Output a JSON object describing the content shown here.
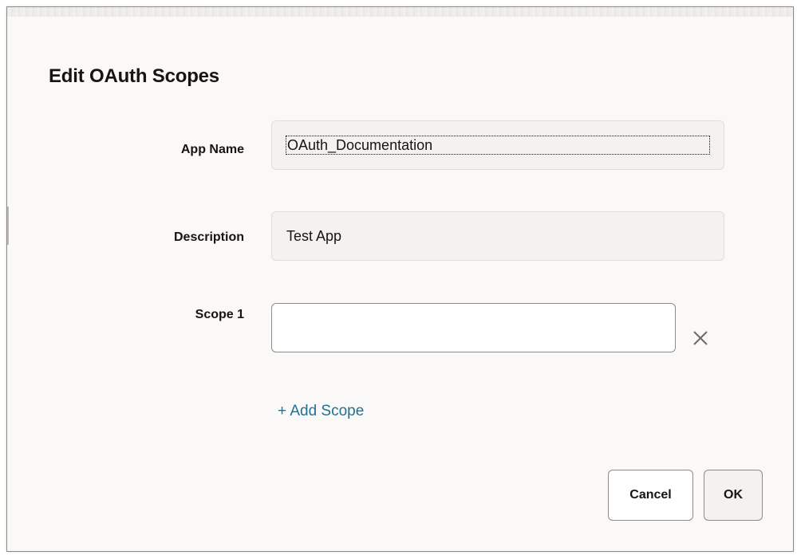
{
  "dialog": {
    "title": "Edit OAuth Scopes",
    "fields": {
      "app_name": {
        "label": "App Name",
        "value": "OAuth_Documentation"
      },
      "description": {
        "label": "Description",
        "value": "Test App"
      },
      "scope_1": {
        "label": "Scope 1",
        "value": ""
      }
    },
    "remove_icon": "close-icon",
    "add_scope_label": "+ Add Scope",
    "buttons": {
      "cancel": "Cancel",
      "ok": "OK"
    }
  },
  "colors": {
    "link": "#227191",
    "dialog_background": "#fbf9f8",
    "readonly_field": "#f4f1ef",
    "text": "#161513"
  }
}
